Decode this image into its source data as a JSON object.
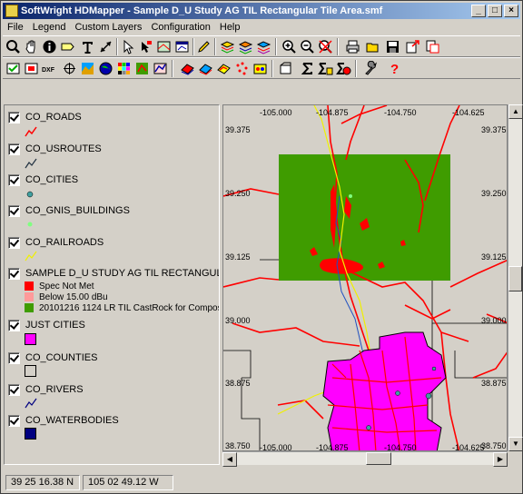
{
  "window": {
    "title": "SoftWright HDMapper - Sample D_U Study AG TIL Rectangular Tile Area.smf",
    "minimize": "_",
    "maximize": "□",
    "close": "×"
  },
  "menu": [
    "File",
    "Legend",
    "Custom Layers",
    "Configuration",
    "Help"
  ],
  "legend": {
    "layers": [
      {
        "name": "CO_ROADS",
        "checked": true,
        "symbol": "red-line-icon"
      },
      {
        "name": "CO_USROUTES",
        "checked": true,
        "symbol": "dark-line-icon"
      },
      {
        "name": "CO_CITIES",
        "checked": true,
        "symbol": "teal-dot-icon"
      },
      {
        "name": "CO_GNIS_BUILDINGS",
        "checked": true,
        "symbol": "green-dot-icon"
      },
      {
        "name": "CO_RAILROADS",
        "checked": true,
        "symbol": "yellow-line-icon"
      },
      {
        "name": "SAMPLE D_U STUDY AG TIL RECTANGULAR TIL",
        "checked": true,
        "symbol": "none"
      },
      {
        "name": "JUST CITIES",
        "checked": true,
        "symbol": "magenta-fill-icon"
      },
      {
        "name": "CO_COUNTIES",
        "checked": true,
        "symbol": "gray-box-icon"
      },
      {
        "name": "CO_RIVERS",
        "checked": true,
        "symbol": "navy-line-icon"
      },
      {
        "name": "CO_WATERBODIES",
        "checked": true,
        "symbol": "navy-fill-icon"
      }
    ],
    "study_classes": [
      {
        "label": "Spec Not Met",
        "color": "#ff0000"
      },
      {
        "label": "Below 15.00 dBu",
        "color": "#ff9a9a"
      },
      {
        "label": "20101216 1124 LR TIL CastRock for Compos",
        "color": "#3f9c00"
      }
    ]
  },
  "map": {
    "top_lon_labels": [
      "-105.000",
      "-104.875",
      "-104.750",
      "-104.625"
    ],
    "bottom_lon_labels": [
      "-105.000",
      "-104.875",
      "-104.750",
      "-104.625"
    ],
    "left_lat_labels": [
      "39.375",
      "39.250",
      "39.125",
      "39.000",
      "38.875",
      "38.750"
    ],
    "right_lat_labels": [
      "39.375",
      "39.250",
      "39.125",
      "39.000",
      "38.875",
      "38.750"
    ],
    "colors": {
      "background": "#d4d0c8",
      "coverage": "#3f9c00",
      "roads": "#ff0000",
      "cities": "#ff00ff",
      "railroads": "#ffff00"
    }
  },
  "status": {
    "lat": "39 25 16.38 N",
    "lon": "105 02 49.12 W"
  }
}
